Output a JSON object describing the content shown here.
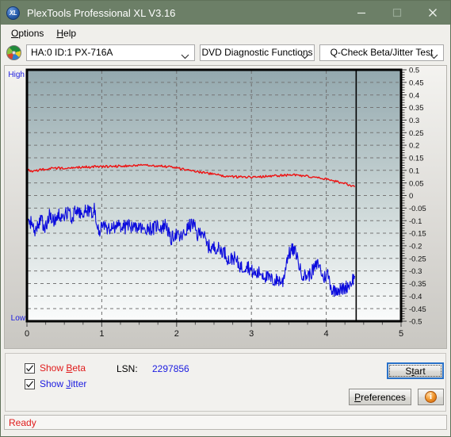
{
  "window": {
    "title": "PlexTools Professional XL V3.16",
    "app_icon": "xl-logo-icon",
    "minimize": "minimize-icon",
    "maximize": "maximize-icon",
    "close": "close-icon",
    "titlebar_color": "#6c7f67"
  },
  "menu": {
    "items": [
      {
        "label": "Options",
        "accel": "O"
      },
      {
        "label": "Help",
        "accel": "H"
      }
    ]
  },
  "toolbar": {
    "drive_icon": "disc-icon",
    "drive_select": "HA:0 ID:1  PX-716A",
    "function_select": "DVD Diagnostic Functions",
    "test_select": "Q-Check Beta/Jitter Test"
  },
  "chart_data": {
    "type": "line",
    "title": "",
    "xlabel": "",
    "ylabel": "",
    "xlim": [
      0,
      5
    ],
    "ylim": [
      -0.5,
      0.5
    ],
    "grid": true,
    "legend_position": "bottom-left",
    "axis_high_label": "High",
    "axis_low_label": "Low",
    "xticks": [
      0,
      1,
      2,
      3,
      4,
      5
    ],
    "xtick_labels": [
      "0",
      "1",
      "2",
      "3",
      "4",
      "5"
    ],
    "yticks": [
      0.5,
      0.45,
      0.4,
      0.35,
      0.3,
      0.25,
      0.2,
      0.15,
      0.1,
      0.05,
      0,
      -0.05,
      -0.1,
      -0.15,
      -0.2,
      -0.25,
      -0.3,
      -0.35,
      -0.4,
      -0.45,
      -0.5
    ],
    "ytick_labels": [
      "0.5",
      "0.45",
      "0.4",
      "0.35",
      "0.3",
      "0.25",
      "0.2",
      "0.15",
      "0.1",
      "0.05",
      "0",
      "-0.05",
      "-0.1",
      "-0.15",
      "-0.2",
      "-0.25",
      "-0.3",
      "-0.35",
      "-0.4",
      "-0.45",
      "-0.5"
    ],
    "data_end_marker_x": 4.4,
    "plot_bg_top_color": "#93a8ae",
    "plot_bg_bottom_color": "#fbfcfc",
    "series": [
      {
        "name": "Beta",
        "color": "#ee1111",
        "x": [
          0.0,
          0.06,
          0.12,
          0.18,
          0.24,
          0.3,
          0.36,
          0.42,
          0.48,
          0.54,
          0.6,
          0.66,
          0.72,
          0.78,
          0.84,
          0.9,
          0.96,
          1.02,
          1.08,
          1.14,
          1.2,
          1.26,
          1.32,
          1.38,
          1.44,
          1.5,
          1.56,
          1.62,
          1.68,
          1.74,
          1.8,
          1.86,
          1.92,
          1.98,
          2.04,
          2.1,
          2.16,
          2.22,
          2.28,
          2.34,
          2.4,
          2.46,
          2.52,
          2.58,
          2.64,
          2.7,
          2.76,
          2.82,
          2.88,
          2.94,
          3.0,
          3.06,
          3.12,
          3.18,
          3.24,
          3.3,
          3.36,
          3.42,
          3.48,
          3.54,
          3.6,
          3.66,
          3.72,
          3.78,
          3.84,
          3.9,
          3.96,
          4.02,
          4.08,
          4.14,
          4.2,
          4.26,
          4.32,
          4.38
        ],
        "y": [
          0.105,
          0.095,
          0.098,
          0.102,
          0.104,
          0.108,
          0.106,
          0.11,
          0.108,
          0.112,
          0.11,
          0.113,
          0.112,
          0.114,
          0.113,
          0.115,
          0.114,
          0.116,
          0.115,
          0.117,
          0.116,
          0.118,
          0.117,
          0.119,
          0.118,
          0.12,
          0.119,
          0.121,
          0.12,
          0.118,
          0.117,
          0.115,
          0.113,
          0.11,
          0.107,
          0.104,
          0.101,
          0.098,
          0.095,
          0.092,
          0.089,
          0.086,
          0.083,
          0.08,
          0.078,
          0.076,
          0.075,
          0.074,
          0.074,
          0.073,
          0.073,
          0.074,
          0.075,
          0.076,
          0.077,
          0.078,
          0.079,
          0.08,
          0.081,
          0.082,
          0.081,
          0.079,
          0.077,
          0.075,
          0.073,
          0.07,
          0.067,
          0.064,
          0.06,
          0.056,
          0.051,
          0.046,
          0.04,
          0.034
        ]
      },
      {
        "name": "Jitter",
        "color": "#0b0bdd",
        "x": [
          0.0,
          0.06,
          0.12,
          0.18,
          0.24,
          0.3,
          0.36,
          0.42,
          0.48,
          0.54,
          0.6,
          0.66,
          0.72,
          0.78,
          0.84,
          0.9,
          0.96,
          1.02,
          1.08,
          1.14,
          1.2,
          1.26,
          1.32,
          1.38,
          1.44,
          1.5,
          1.56,
          1.62,
          1.68,
          1.74,
          1.8,
          1.86,
          1.92,
          1.98,
          2.04,
          2.1,
          2.16,
          2.22,
          2.28,
          2.34,
          2.4,
          2.46,
          2.52,
          2.58,
          2.64,
          2.7,
          2.76,
          2.82,
          2.88,
          2.94,
          3.0,
          3.06,
          3.12,
          3.18,
          3.24,
          3.3,
          3.36,
          3.42,
          3.48,
          3.54,
          3.6,
          3.66,
          3.72,
          3.78,
          3.84,
          3.9,
          3.96,
          4.02,
          4.08,
          4.14,
          4.2,
          4.26,
          4.32,
          4.38
        ],
        "y": [
          -0.125,
          -0.1,
          -0.145,
          -0.085,
          -0.135,
          -0.075,
          -0.11,
          -0.07,
          -0.095,
          -0.065,
          -0.085,
          -0.06,
          -0.075,
          -0.058,
          -0.07,
          -0.055,
          -0.14,
          -0.125,
          -0.135,
          -0.12,
          -0.13,
          -0.118,
          -0.128,
          -0.12,
          -0.132,
          -0.122,
          -0.14,
          -0.125,
          -0.135,
          -0.118,
          -0.128,
          -0.112,
          -0.18,
          -0.15,
          -0.17,
          -0.155,
          -0.125,
          -0.11,
          -0.16,
          -0.135,
          -0.195,
          -0.21,
          -0.205,
          -0.215,
          -0.225,
          -0.26,
          -0.245,
          -0.27,
          -0.29,
          -0.275,
          -0.3,
          -0.315,
          -0.305,
          -0.32,
          -0.33,
          -0.34,
          -0.335,
          -0.345,
          -0.245,
          -0.215,
          -0.23,
          -0.305,
          -0.32,
          -0.315,
          -0.29,
          -0.27,
          -0.33,
          -0.31,
          -0.38,
          -0.37,
          -0.375,
          -0.365,
          -0.35,
          -0.32
        ]
      }
    ]
  },
  "controls": {
    "show_beta": {
      "label": "Show ",
      "accel": "B",
      "rest": "eta",
      "checked": true,
      "color": "#e01b1b"
    },
    "show_jitter": {
      "label": "Show ",
      "accel": "J",
      "rest": "itter",
      "checked": true,
      "color": "#1b1be0"
    },
    "lsn_label": "LSN:",
    "lsn_value": "2297856",
    "start_button": {
      "pre": "S",
      "accel": "t",
      "post": "art",
      "full": "Start"
    },
    "preferences_button": {
      "accel": "P",
      "rest": "references",
      "full": "Preferences"
    },
    "info_button": "info-icon",
    "info_glyph": "i"
  },
  "statusbar": {
    "text": "Ready"
  }
}
